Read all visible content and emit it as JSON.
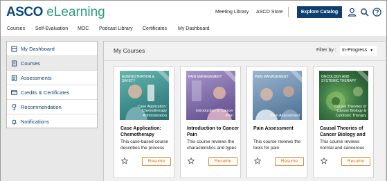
{
  "header": {
    "logo_brand": "ASCO",
    "logo_product": "eLearning",
    "links": [
      "Meeting Library",
      "ASCO Store"
    ],
    "explore_label": "Explore Catalog",
    "icons": [
      "user-icon",
      "search-icon",
      "help-icon"
    ]
  },
  "nav": {
    "items": [
      "Courses",
      "Self-Evaluation",
      "MOC",
      "Podcast Library",
      "Certificates",
      "My Dashboard"
    ]
  },
  "sidebar": {
    "items": [
      {
        "label": "My Dashboard",
        "icon": "dashboard-icon"
      },
      {
        "label": "Courses",
        "icon": "document-icon",
        "active": true
      },
      {
        "label": "Assessments",
        "icon": "list-icon"
      },
      {
        "label": "Credits & Certificates",
        "icon": "credit-card-icon"
      },
      {
        "label": "Recommendation",
        "icon": "trophy-icon"
      },
      {
        "label": "Notifications",
        "icon": "bell-icon"
      }
    ]
  },
  "main": {
    "title": "My Courses",
    "filter_label": "Filter by :",
    "filter_value": "In-Progress",
    "courses": [
      {
        "category": "Administration & Safety",
        "caption": "Case Application: Chemotherapy Administration",
        "title": "Case Application: Chemotherapy",
        "description": "This case-based course describes the process",
        "action": "Resume",
        "color": "#3f8f8c"
      },
      {
        "category": "Pain Management",
        "caption": "Introduction to Cancer Pain",
        "title": "Introduction to Cancer Pain",
        "description": "This course reviews the characteristics and types",
        "action": "Resume",
        "color": "#7f6ca8"
      },
      {
        "category": "Pain Management",
        "caption": "Pain Assessment",
        "title": "Pain Assessment",
        "description": "This course reviews the tools for pain",
        "action": "Resume",
        "color": "#6d8fb0"
      },
      {
        "category": "Oncology and Systemic Therapy",
        "caption": "Causal Theories of Cancer Biology & Cytotoxic Therapy",
        "title": "Causal Theories of Cancer Biology and",
        "description": "This course reviews normal and cancerous",
        "action": "Resume",
        "color": "#3d7a45"
      }
    ]
  },
  "colors": {
    "brand_blue": "#0e3f70",
    "brand_green": "#2c9a7c",
    "resume_orange": "#e08a2b"
  }
}
